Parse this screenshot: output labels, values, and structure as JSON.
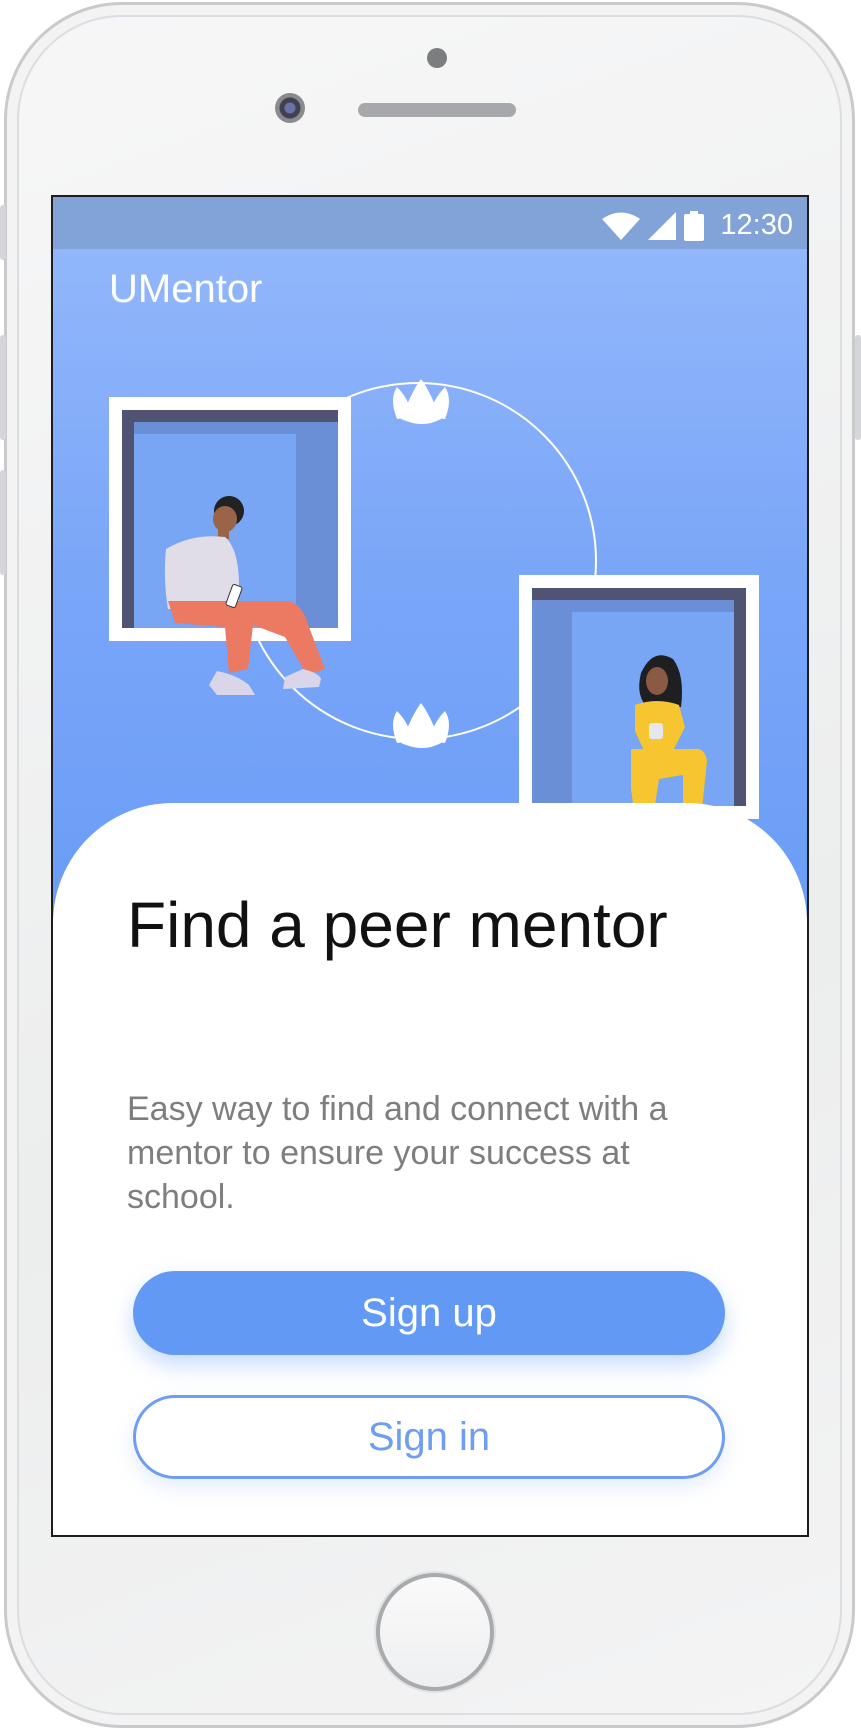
{
  "status_bar": {
    "time": "12:30",
    "icons": [
      "wifi-icon",
      "cellular-signal-icon",
      "battery-icon"
    ]
  },
  "app": {
    "title": "UMentor"
  },
  "onboarding": {
    "headline": "Find a peer mentor",
    "description": "Easy way to find and connect with a mentor to ensure your success at school."
  },
  "actions": {
    "signup_label": "Sign up",
    "signin_label": "Sign in"
  },
  "colors": {
    "accent": "#6299F5",
    "hero_top": "#95B9FB",
    "hero_bottom": "#659AF6",
    "status_bar": "#81A3D8",
    "headline": "#111111",
    "body_text": "#7E7E7E"
  }
}
